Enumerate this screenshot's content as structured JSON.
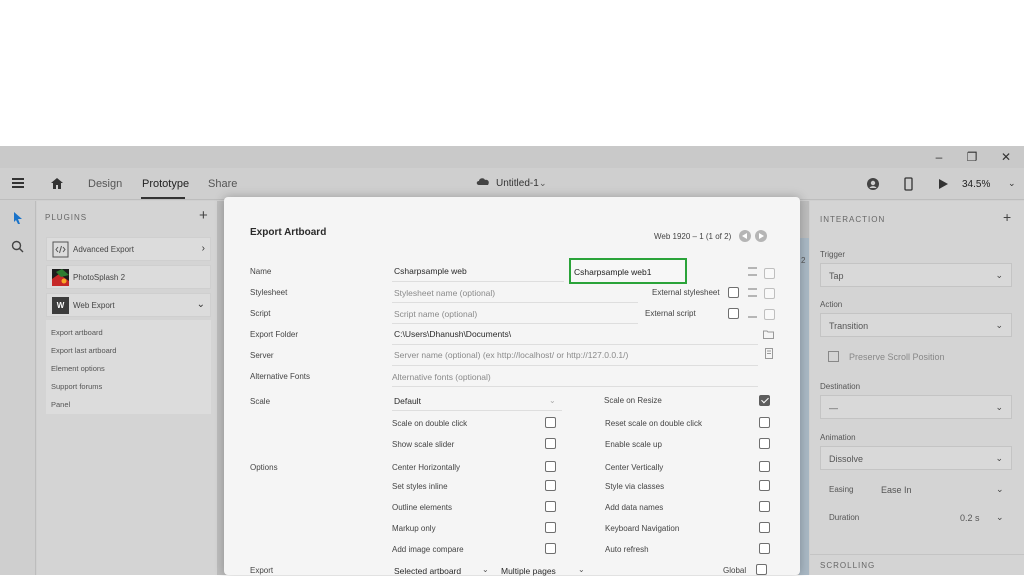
{
  "window": {
    "minimize": "–",
    "maximize": "❐",
    "close": "✕"
  },
  "menubar": {
    "tabs": [
      "Design",
      "Prototype",
      "Share"
    ],
    "doc_name": "Untitled-1",
    "zoom": "34.5%"
  },
  "plugins": {
    "title": "PLUGINS",
    "items": [
      {
        "label": "Advanced Export",
        "icon": "code-icon"
      },
      {
        "label": "PhotoSplash 2",
        "icon": "photosplash-icon"
      },
      {
        "label": "Web Export",
        "icon": "web-export-icon",
        "badge": "W"
      }
    ],
    "sub_items": [
      "Export artboard",
      "Export last artboard",
      "Element options",
      "Support forums",
      "Panel"
    ]
  },
  "canvas": {
    "artboard_number": "2"
  },
  "right_panel": {
    "section": "INTERACTION",
    "trigger_label": "Trigger",
    "trigger_value": "Tap",
    "action_label": "Action",
    "action_value": "Transition",
    "preserve_scroll": "Preserve Scroll Position",
    "destination_label": "Destination",
    "destination_value": "—",
    "animation_label": "Animation",
    "animation_value": "Dissolve",
    "easing_label": "Easing",
    "easing_value": "Ease In",
    "duration_label": "Duration",
    "duration_value": "0.2 s",
    "scrolling": "SCROLLING"
  },
  "dialog": {
    "title": "Export Artboard",
    "page_info": "Web 1920 – 1 (1 of 2)",
    "labels": {
      "name": "Name",
      "stylesheet": "Stylesheet",
      "script": "Script",
      "export_folder": "Export Folder",
      "server": "Server",
      "alt_fonts": "Alternative Fonts",
      "scale": "Scale",
      "options": "Options",
      "export": "Export"
    },
    "fields": {
      "name_value": "Csharpsample web",
      "name_highlight": "Csharpsample web1",
      "stylesheet_placeholder": "Stylesheet name (optional)",
      "script_placeholder": "Script name (optional)",
      "export_folder_value": "C:\\Users\\Dhanush\\Documents\\",
      "server_placeholder": "Server name (optional) (ex http://localhost/ or http://127.0.0.1/)",
      "alt_fonts_placeholder": "Alternative fonts (optional)",
      "scale_value": "Default",
      "export_value": "Selected artboard",
      "export_pages": "Multiple pages"
    },
    "external_stylesheet": "External stylesheet",
    "external_script": "External script",
    "scale_on_resize": "Scale on Resize",
    "global": "Global",
    "left_options": [
      "Scale on double click",
      "Show scale slider",
      "Center Horizontally",
      "Set styles inline",
      "Outline elements",
      "Markup only",
      "Add image compare"
    ],
    "right_options": [
      "Reset scale on double click",
      "Enable scale up",
      "Center Vertically",
      "Style via classes",
      "Add data names",
      "Keyboard Navigation",
      "Auto refresh"
    ]
  }
}
